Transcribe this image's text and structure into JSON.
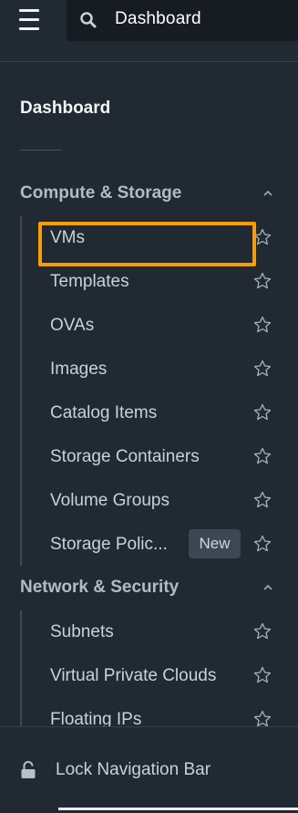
{
  "search": {
    "value": "Dashboard"
  },
  "nav": {
    "dashboard_label": "Dashboard",
    "sections": [
      {
        "title": "Compute & Storage",
        "items": [
          {
            "label": "VMs"
          },
          {
            "label": "Templates"
          },
          {
            "label": "OVAs"
          },
          {
            "label": "Images"
          },
          {
            "label": "Catalog Items"
          },
          {
            "label": "Storage Containers"
          },
          {
            "label": "Volume Groups"
          },
          {
            "label": "Storage Polic...",
            "badge": "New"
          }
        ]
      },
      {
        "title": "Network & Security",
        "items": [
          {
            "label": "Subnets"
          },
          {
            "label": "Virtual Private Clouds"
          },
          {
            "label": "Floating IPs"
          }
        ]
      }
    ]
  },
  "footer": {
    "lock_label": "Lock Navigation Bar"
  },
  "colors": {
    "background": "#212932",
    "search_background": "#161c22",
    "highlight": "#ff9c00",
    "badge_background": "#3b4753"
  },
  "icons": {
    "menu": "hamburger-icon",
    "search": "search-icon",
    "collapse": "chevron-up-icon",
    "favorite": "star-outline-icon",
    "lock": "unlock-icon"
  }
}
